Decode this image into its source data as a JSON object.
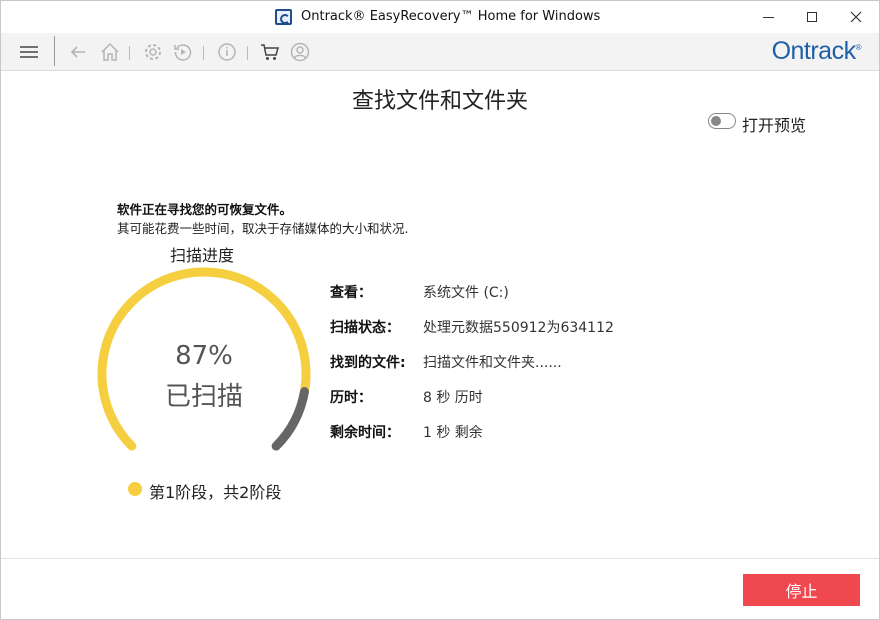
{
  "window": {
    "title": "Ontrack® EasyRecovery™ Home for Windows"
  },
  "toolbar": {
    "icons": [
      "menu-icon",
      "back-icon",
      "home-icon",
      "settings-icon",
      "history-icon",
      "info-icon",
      "cart-icon",
      "account-icon"
    ],
    "brand": "Ontrack",
    "brand_mark": "®"
  },
  "main": {
    "title": "查找文件和文件夹",
    "preview_toggle": {
      "label": "打开预览",
      "on": false
    },
    "info_bold": "软件正在寻找您的可恢复文件。",
    "info_sub": "其可能花费一些时间，取决于存储媒体的大小和状况.",
    "progress": {
      "title": "扫描进度",
      "percent": 87,
      "percent_text": "87%",
      "label": "已扫描",
      "stage_text": "第1阶段，共2阶段"
    },
    "details": [
      {
        "key": "查看：",
        "value": "系统文件 (C:)"
      },
      {
        "key": "扫描状态：",
        "value": "处理元数据550912为634112"
      },
      {
        "key": "找到的文件:",
        "value": "扫描文件和文件夹......"
      },
      {
        "key": "历时：",
        "value": "8 秒 历时"
      },
      {
        "key": "剩余时间：",
        "value": "1 秒 剩余"
      }
    ]
  },
  "footer": {
    "stop_label": "停止"
  },
  "colors": {
    "accent_yellow": "#f5cf3f",
    "gauge_remaining": "#666666",
    "stop_button": "#f0484f",
    "brand_blue": "#1f5fa8"
  }
}
